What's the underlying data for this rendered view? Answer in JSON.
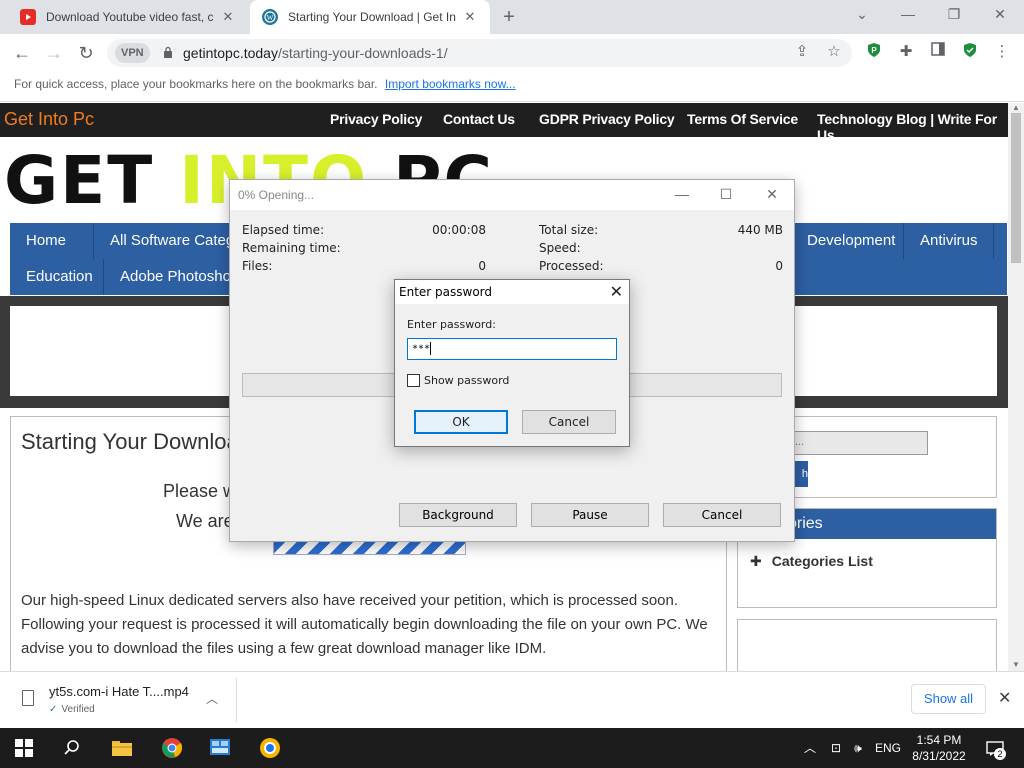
{
  "browser": {
    "tabs": [
      {
        "title": "Download Youtube video fast, co",
        "active": false
      },
      {
        "title": "Starting Your Download | Get Int",
        "active": true
      }
    ],
    "url_host": "getintopc.today",
    "url_path": "/starting-your-downloads-1/",
    "vpn_label": "VPN",
    "bookmarks_hint": "For quick access, place your bookmarks here on the bookmarks bar.",
    "bookmarks_import": "Import bookmarks now..."
  },
  "site": {
    "brand": "Get Into Pc",
    "top_links": [
      "Privacy Policy",
      "Contact Us",
      "GDPR Privacy Policy",
      "Terms Of Service",
      "Technology Blog | Write For Us"
    ],
    "logo_part1": "GET ",
    "logo_part2": "INTO",
    "logo_part3": " PC",
    "nav_row1": [
      "Home",
      "All Software Catego",
      "Development",
      "Antivirus"
    ],
    "nav_row2": [
      "Education",
      "Adobe Photoshop"
    ],
    "content_title": "Starting Your Downloa",
    "content_line1": "Please w",
    "content_line2": "We are",
    "paragraph": "Our high-speed Linux dedicated servers also have received your petition, which is processed soon. Following your request is processed it will automatically begin downloading the file on your own PC. We advise you to download the files using a few great download manager like IDM.",
    "sidebar_search_placeholder": "...",
    "sidebar_go": "h",
    "sidebar_heading": "ories",
    "categories_list": "Categories List"
  },
  "extract_window": {
    "title": "0% Opening...",
    "elapsed_label": "Elapsed time:",
    "elapsed_value": "00:00:08",
    "remaining_label": "Remaining time:",
    "files_label": "Files:",
    "files_value": "0",
    "total_label": "Total size:",
    "total_value": "440 MB",
    "speed_label": "Speed:",
    "processed_label": "Processed:",
    "processed_value": "0",
    "btn_background": "Background",
    "btn_pause": "Pause",
    "btn_cancel": "Cancel"
  },
  "password_dialog": {
    "title": "Enter password",
    "label": "Enter password:",
    "value": "***",
    "show_password": "Show password",
    "ok": "OK",
    "cancel": "Cancel"
  },
  "download_bar": {
    "file_name": "yt5s.com-i Hate T....mp4",
    "status": "Verified",
    "show_all": "Show all"
  },
  "taskbar": {
    "language": "ENG",
    "time": "1:54 PM",
    "date": "8/31/2022",
    "notifications": "2"
  },
  "colors": {
    "site_nav_blue": "#2d5fa3",
    "brand_orange": "#f07c1c",
    "logo_lime": "#d8f02b",
    "focus_blue": "#0078d7"
  }
}
